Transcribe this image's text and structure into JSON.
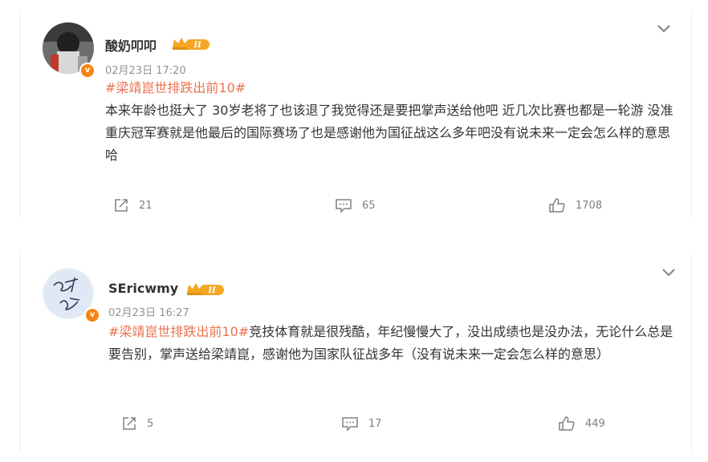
{
  "posts": [
    {
      "username": "酸奶叩叩",
      "vip_level": "II",
      "verified_badge": "v",
      "timestamp": "02月23日 17:20",
      "hashtag": "#梁靖崑世排跌出前10#",
      "text": "本来年龄也挺大了 30岁老将了也该退了我觉得还是要把掌声送给他吧 近几次比赛也都是一轮游 没准重庆冠军赛就是他最后的国际赛场了也是感谢他为国征战这么多年吧没有说未来一定会怎么样的意思哈",
      "reposts": "21",
      "comments": "65",
      "likes": "1708"
    },
    {
      "username": "SEricwmy",
      "vip_level": "II",
      "verified_badge": "v",
      "timestamp": "02月23日 16:27",
      "hashtag": "#梁靖崑世排跌出前10#",
      "text": "竞技体育就是很残酷，年纪慢慢大了，没出成绩也是没办法，无论什么总是要告别，掌声送给梁靖崑，感谢他为国家队征战多年（没有说未来一定会怎么样的意思）",
      "reposts": "5",
      "comments": "17",
      "likes": "449"
    }
  ],
  "colors": {
    "hashtag": "#eb7350",
    "meta": "#939393",
    "action": "#808080",
    "badge": "#f78414",
    "vip_gold": "#f5a623"
  },
  "icons": [
    "chevron-down-icon",
    "repost-icon",
    "comment-icon",
    "like-icon",
    "vip-crown-icon"
  ]
}
